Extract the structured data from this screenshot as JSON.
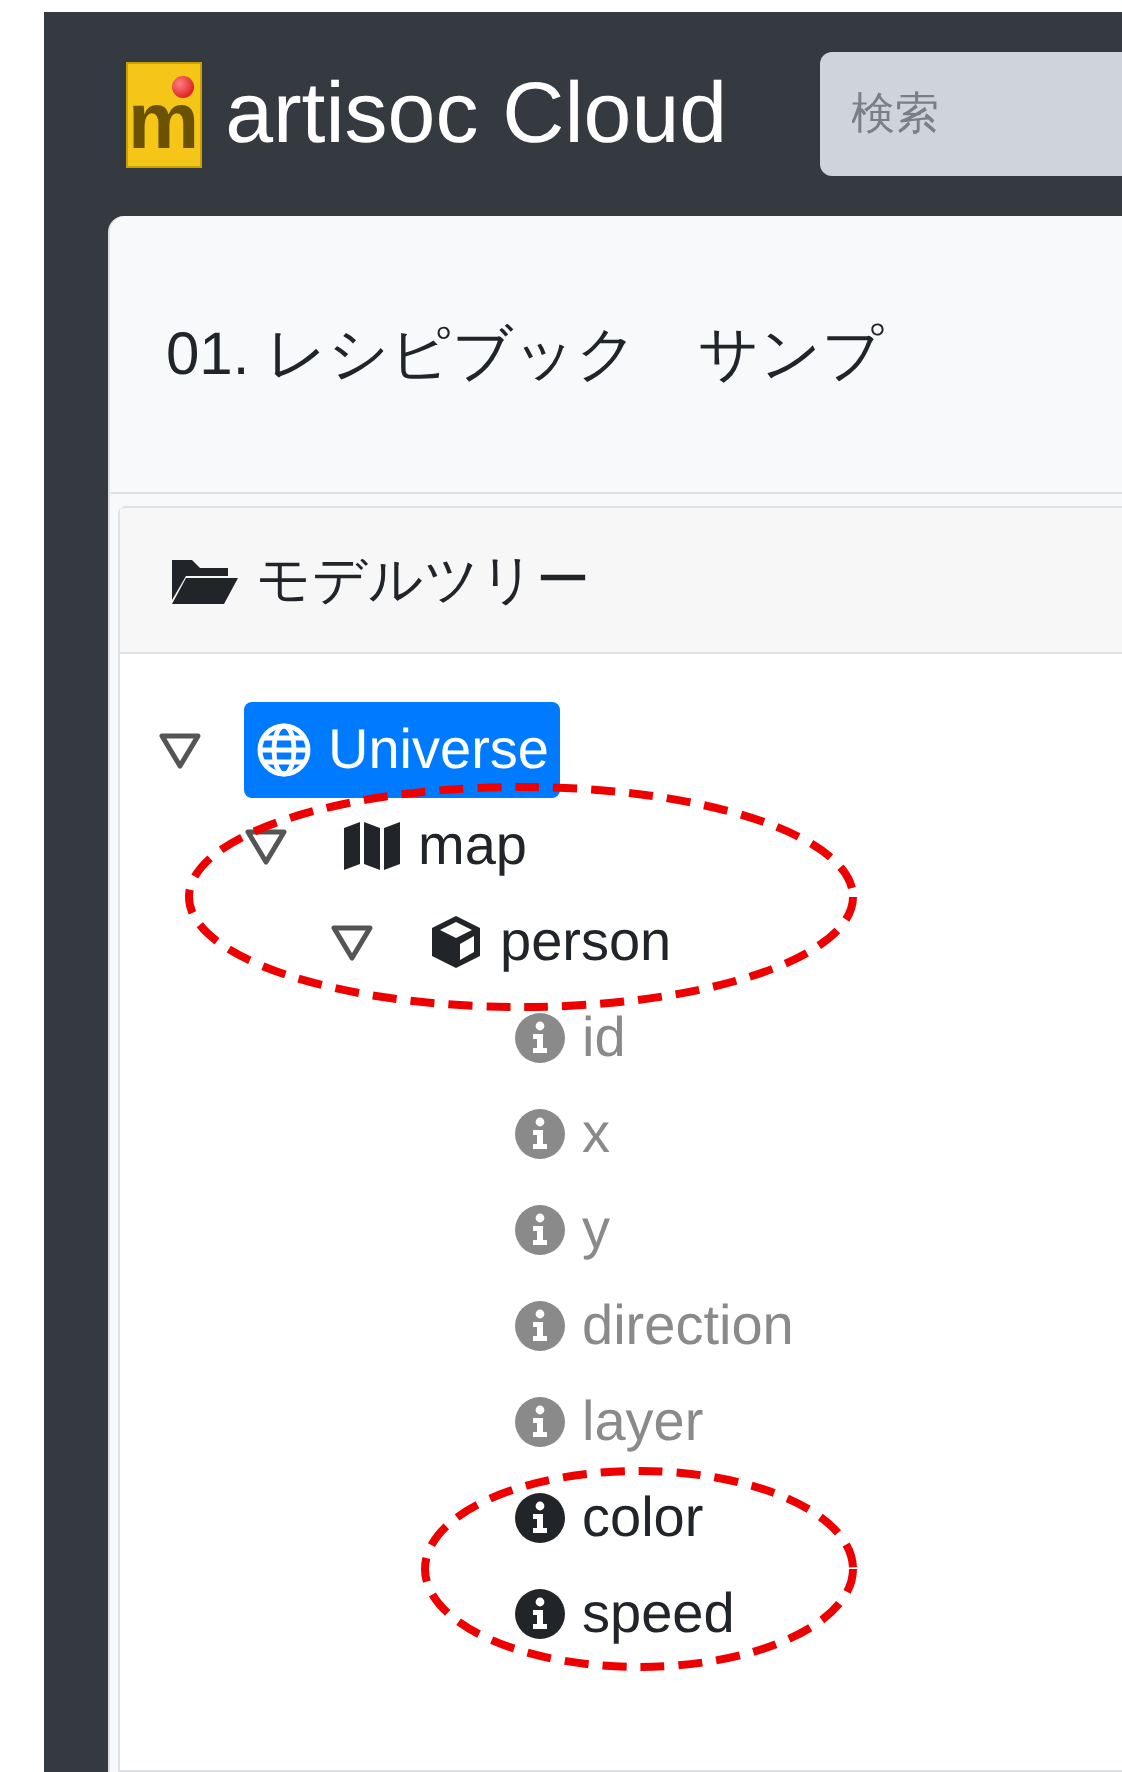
{
  "header": {
    "logo_letter": "m",
    "title": "artisoc Cloud",
    "search": {
      "placeholder": "検索"
    }
  },
  "card": {
    "title": "01. レシピブック　サンプ"
  },
  "panel": {
    "title": "モデルツリー"
  },
  "tree": [
    {
      "kind": "universe",
      "label": "Universe",
      "selected": true,
      "expanded": true,
      "children": [
        {
          "kind": "space",
          "label": "map",
          "selected": false,
          "expanded": true,
          "children": [
            {
              "kind": "agent",
              "label": "person",
              "selected": false,
              "expanded": true,
              "children": [
                {
                  "kind": "variable",
                  "label": "id",
                  "selected": false,
                  "disabled": true
                },
                {
                  "kind": "variable",
                  "label": "x",
                  "selected": false,
                  "disabled": true
                },
                {
                  "kind": "variable",
                  "label": "y",
                  "selected": false,
                  "disabled": true
                },
                {
                  "kind": "variable",
                  "label": "direction",
                  "selected": false,
                  "disabled": true
                },
                {
                  "kind": "variable",
                  "label": "layer",
                  "selected": false,
                  "disabled": true
                },
                {
                  "kind": "variable",
                  "label": "color",
                  "selected": false,
                  "disabled": false
                },
                {
                  "kind": "variable",
                  "label": "speed",
                  "selected": false,
                  "disabled": false
                }
              ]
            }
          ]
        }
      ]
    }
  ]
}
